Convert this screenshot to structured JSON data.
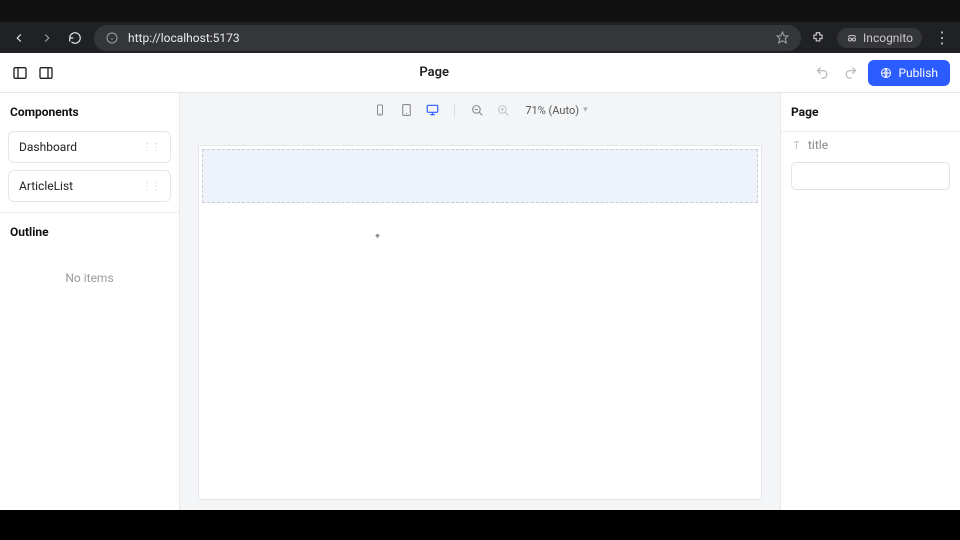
{
  "browser": {
    "url": "http://localhost:5173",
    "incognito_label": "Incognito"
  },
  "topbar": {
    "title": "Page",
    "publish_label": "Publish"
  },
  "left": {
    "components_heading": "Components",
    "components": [
      {
        "name": "Dashboard"
      },
      {
        "name": "ArticleList"
      }
    ],
    "outline_heading": "Outline",
    "outline_empty": "No items"
  },
  "canvas": {
    "zoom_label": "71% (Auto)"
  },
  "right": {
    "heading": "Page",
    "title_label": "title",
    "title_value": ""
  }
}
